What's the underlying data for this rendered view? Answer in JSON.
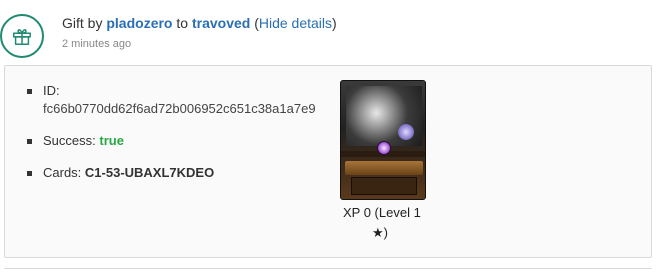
{
  "header": {
    "prefix": "Gift by ",
    "from_user": "pladozero",
    "connector": " to ",
    "to_user": "travoved",
    "open_paren": " (",
    "toggle_label": "Hide details",
    "close_paren": ")",
    "time": "2 minutes ago",
    "icon": "gift-icon"
  },
  "details": {
    "id_label": "ID:",
    "id_value": "fc66b0770dd62f6ad72b006952c651c38a1a7e9",
    "success_label": "Success: ",
    "success_value": "true",
    "cards_label": "Cards: ",
    "cards_value": "C1-53-UBAXL7KDEO"
  },
  "card": {
    "xp_text": "XP 0 (Level 1",
    "star_glyph": "★",
    "star_suffix": ")"
  },
  "colors": {
    "link": "#2a6fb5",
    "success": "#28a745",
    "gift_icon": "#1f8a70"
  }
}
